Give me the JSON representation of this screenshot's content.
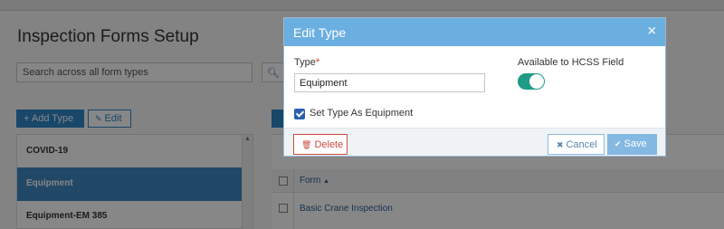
{
  "background": {
    "title": "Inspection Forms Setup",
    "search_placeholder": "Search across all form types",
    "add_type_label": "+ Add Type",
    "edit_label": "Edit",
    "types": [
      {
        "label": "COVID-19",
        "active": false
      },
      {
        "label": "Equipment",
        "active": true
      },
      {
        "label": "Equipment-EM 385",
        "active": false
      }
    ],
    "forms_column_header": "Form",
    "sort_indicator": "▲",
    "forms": [
      "Basic Crane Inspection"
    ]
  },
  "modal": {
    "title": "Edit Type",
    "close_icon": "×",
    "type_label": "Type",
    "required_mark": "*",
    "type_value": "Equipment",
    "hcss_label": "Available to HCSS Field",
    "hcss_enabled": true,
    "equipment_checkbox_label": "Set Type As Equipment",
    "equipment_checked": true,
    "delete_label": "Delete",
    "cancel_label": "Cancel",
    "save_label": "Save"
  },
  "colors": {
    "header": "#6baee0",
    "toggle_on": "#1f9b87",
    "delete": "#c94b3f",
    "save": "#84b9e4",
    "primary": "#2f86c8"
  }
}
